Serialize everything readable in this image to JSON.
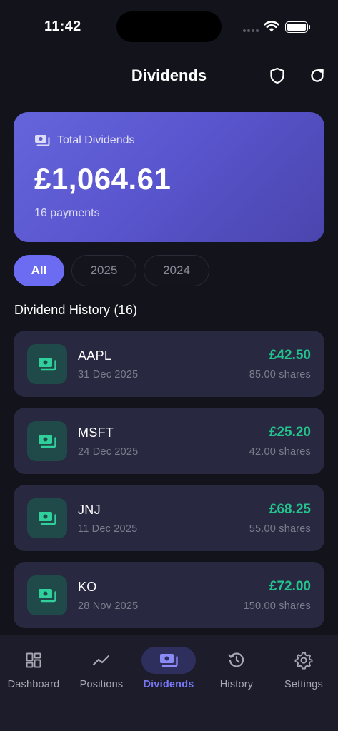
{
  "status_bar": {
    "time": "11:42"
  },
  "header": {
    "title": "Dividends"
  },
  "summary": {
    "label": "Total Dividends",
    "amount": "£1,064.61",
    "count": "16 payments"
  },
  "filters": [
    {
      "label": "All",
      "active": true
    },
    {
      "label": "2025",
      "active": false
    },
    {
      "label": "2024",
      "active": false
    }
  ],
  "section_title": "Dividend History (16)",
  "dividends": [
    {
      "ticker": "AAPL",
      "date": "31 Dec 2025",
      "amount": "£42.50",
      "shares": "85.00 shares"
    },
    {
      "ticker": "MSFT",
      "date": "24 Dec 2025",
      "amount": "£25.20",
      "shares": "42.00 shares"
    },
    {
      "ticker": "JNJ",
      "date": "11 Dec 2025",
      "amount": "£68.25",
      "shares": "55.00 shares"
    },
    {
      "ticker": "KO",
      "date": "28 Nov 2025",
      "amount": "£72.00",
      "shares": "150.00 shares"
    }
  ],
  "tabs": [
    {
      "label": "Dashboard",
      "icon": "dashboard-icon"
    },
    {
      "label": "Positions",
      "icon": "trend-icon"
    },
    {
      "label": "Dividends",
      "icon": "money-icon",
      "active": true
    },
    {
      "label": "History",
      "icon": "history-icon"
    },
    {
      "label": "Settings",
      "icon": "gear-icon"
    }
  ],
  "colors": {
    "background": "#13131c",
    "accent": "#6c6cf2",
    "positive": "#23c38e",
    "card": "#282840"
  }
}
